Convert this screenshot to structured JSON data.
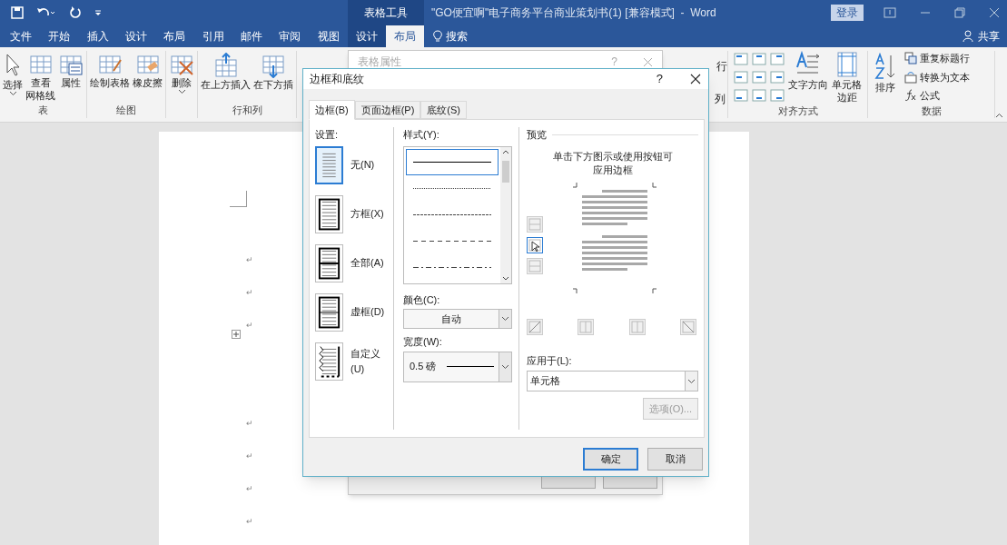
{
  "title_bar": {
    "context_label": "表格工具",
    "title": "\"GO便宜啊\"电子商务平台商业策划书(1) [兼容模式]  -  Word",
    "sign_in": "登录"
  },
  "ribbon_tabs": [
    {
      "label": "文件",
      "selected": false,
      "kind": "main"
    },
    {
      "label": "开始",
      "selected": false,
      "kind": "main"
    },
    {
      "label": "插入",
      "selected": false,
      "kind": "main"
    },
    {
      "label": "设计",
      "selected": false,
      "kind": "main"
    },
    {
      "label": "布局",
      "selected": false,
      "kind": "main"
    },
    {
      "label": "引用",
      "selected": false,
      "kind": "main"
    },
    {
      "label": "邮件",
      "selected": false,
      "kind": "main"
    },
    {
      "label": "审阅",
      "selected": false,
      "kind": "main"
    },
    {
      "label": "视图",
      "selected": false,
      "kind": "main"
    },
    {
      "label": "设计",
      "selected": false,
      "kind": "context"
    },
    {
      "label": "布局",
      "selected": true,
      "kind": "context"
    }
  ],
  "search": "搜索",
  "share": "共享",
  "ribbon_groups": [
    {
      "label": "表",
      "buttons": [
        {
          "label": "选择",
          "kind": "cursor",
          "dropdown": true
        },
        {
          "lines": [
            "查看",
            "网格线"
          ],
          "kind": "grid",
          "dropdown": false
        },
        {
          "label": "属性",
          "kind": "properties",
          "dropdown": false
        }
      ]
    },
    {
      "label": "绘图",
      "buttons": [
        {
          "label": "绘制表格",
          "kind": "draw",
          "dropdown": false
        },
        {
          "label": "橡皮擦",
          "kind": "eraser",
          "dropdown": false
        }
      ]
    },
    {
      "buttons": [
        {
          "label": "删除",
          "kind": "delete",
          "dropdown": true
        }
      ]
    },
    {
      "label": "行和列",
      "buttons": [
        {
          "label": "在上方插入",
          "kind": "insert-above",
          "dropdown": false
        },
        {
          "label": "在下方插",
          "kind": "insert-below",
          "dropdown": false
        }
      ]
    }
  ],
  "distribute": [
    "行",
    "列"
  ],
  "align_group": {
    "label": "对齐方式",
    "text_direction": "文字方向",
    "cell_margins": [
      "单元格",
      "边距"
    ]
  },
  "data_group": {
    "label": "数据",
    "sort": "排序",
    "items": [
      {
        "label": "重复标题行",
        "kind": "repeat"
      },
      {
        "label": "转换为文本",
        "kind": "convert"
      },
      {
        "label": "公式",
        "kind": "formula"
      }
    ]
  },
  "document": {
    "paragraphs_before_table": [
      "↵",
      "↵",
      "↵"
    ],
    "paragraphs_after_table": [
      "↵",
      "↵",
      "↵",
      "↵"
    ]
  },
  "table_properties_dialog": {
    "title": "表格属性",
    "help": "?"
  },
  "borders_dialog": {
    "title": "边框和底纹",
    "help": "?",
    "tabs": [
      {
        "label": "边框(B)",
        "selected": true
      },
      {
        "label": "页面边框(P)",
        "selected": false
      },
      {
        "label": "底纹(S)",
        "selected": false
      }
    ],
    "settings_label": "设置:",
    "settings": [
      {
        "label": "无(N)",
        "kind": "none",
        "selected": true
      },
      {
        "label": "方框(X)",
        "kind": "box",
        "selected": false
      },
      {
        "label": "全部(A)",
        "kind": "all",
        "selected": false
      },
      {
        "label": "虚框(D)",
        "kind": "grid",
        "selected": false
      },
      {
        "label": "自定义(U)",
        "kind": "custom",
        "selected": false
      }
    ],
    "style_label": "样式(Y):",
    "styles": [
      {
        "kind": "solid",
        "selected": true
      },
      {
        "kind": "dotted",
        "selected": false
      },
      {
        "kind": "fine-dash",
        "selected": false
      },
      {
        "kind": "dash",
        "selected": false
      },
      {
        "kind": "dash-dot",
        "selected": false
      }
    ],
    "color_label": "颜色(C):",
    "color_value": "自动",
    "width_label": "宽度(W):",
    "width_value": "0.5 磅",
    "preview_label": "预览",
    "preview_hint": "单击下方图示或使用按钮可应用边框",
    "side_buttons": [
      {
        "kind": "top",
        "selected": false
      },
      {
        "kind": "inside-horizontal",
        "selected": true
      },
      {
        "kind": "bottom",
        "selected": false
      }
    ],
    "bottom_buttons": [
      {
        "kind": "diagonal-up",
        "selected": false
      },
      {
        "kind": "left",
        "selected": false
      },
      {
        "kind": "right",
        "selected": false
      },
      {
        "kind": "diagonal-down",
        "selected": false
      }
    ],
    "apply_label": "应用于(L):",
    "apply_value": "单元格",
    "options_button": {
      "label": "选项(O)...",
      "disabled": true
    },
    "ok": "确定",
    "cancel": "取消"
  }
}
